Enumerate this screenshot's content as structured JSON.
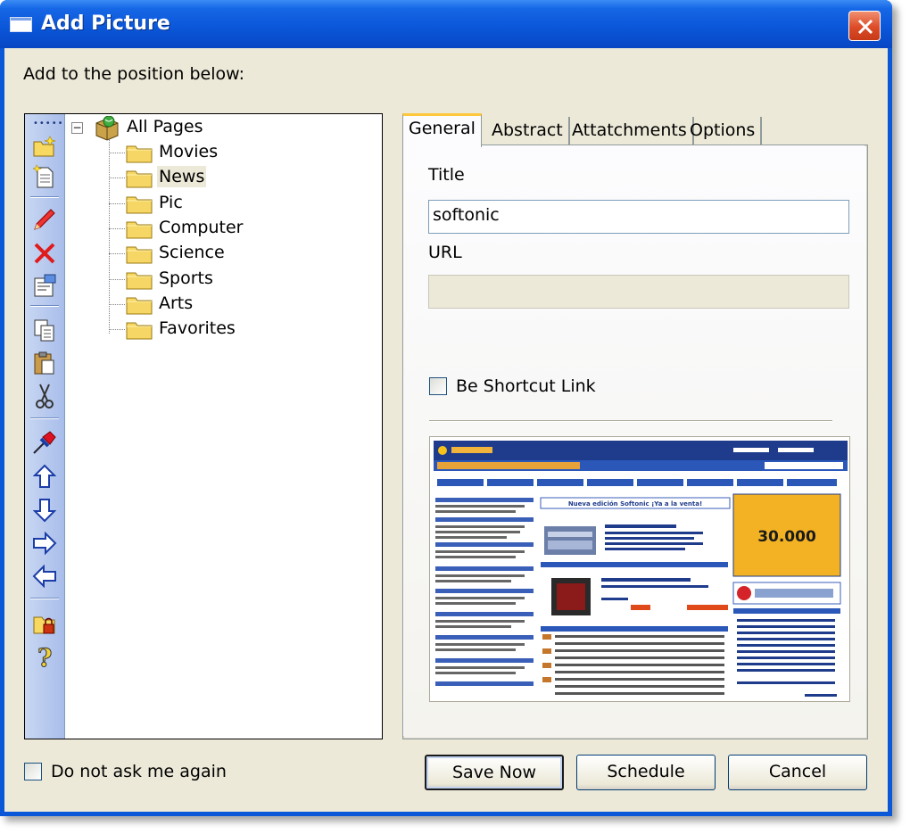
{
  "window": {
    "title": "Add Picture"
  },
  "prompt": "Add to the position below:",
  "toolbar": {
    "buttons": [
      "new-folder-icon",
      "new-page-icon",
      "edit-icon",
      "delete-icon",
      "properties-icon",
      "copy-icon",
      "paste-icon",
      "cut-icon",
      "pin-icon",
      "move-up-icon",
      "move-down-icon",
      "indent-icon",
      "outdent-icon",
      "lock-icon",
      "help-icon"
    ]
  },
  "tree": {
    "root": "All Pages",
    "nodes": [
      "Movies",
      "News",
      "Pic",
      "Computer",
      "Science",
      "Sports",
      "Arts",
      "Favorites"
    ],
    "selected": "News"
  },
  "tabs": [
    "General",
    "Abstract",
    "Attatchments",
    "Options"
  ],
  "active_tab": "General",
  "form": {
    "title_label": "Title",
    "title_value": "softonic",
    "url_label": "URL",
    "url_value": "",
    "shortcut_label": "Be Shortcut Link"
  },
  "preview": {
    "counter_text": "30.000",
    "banner_text": "Nueva edición Softonic ¡Ya a la venta!"
  },
  "dont_ask_label": "Do not ask me again",
  "buttons": {
    "save": "Save Now",
    "schedule": "Schedule",
    "cancel": "Cancel"
  },
  "colors": {
    "title_bar": "#0a55d8",
    "client_bg": "#ece9d8",
    "close_button": "#dd4b27",
    "tab_highlight": "#ffc83c"
  }
}
